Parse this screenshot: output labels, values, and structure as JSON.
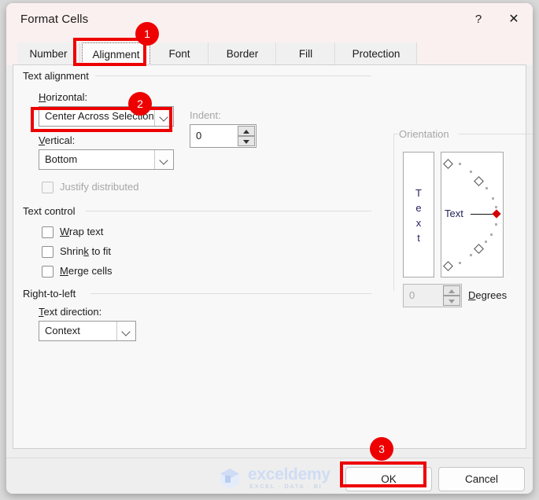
{
  "window": {
    "title": "Format Cells",
    "help_icon": "?",
    "close_icon": "✕"
  },
  "tabs": [
    {
      "label": "Number",
      "active": false
    },
    {
      "label": "Alignment",
      "active": true
    },
    {
      "label": "Font",
      "active": false
    },
    {
      "label": "Border",
      "active": false
    },
    {
      "label": "Fill",
      "active": false
    },
    {
      "label": "Protection",
      "active": false
    }
  ],
  "text_alignment": {
    "group_label": "Text alignment",
    "horizontal_label": "Horizontal:",
    "horizontal_value": "Center Across Selection",
    "vertical_label": "Vertical:",
    "vertical_value": "Bottom",
    "indent_label": "Indent:",
    "indent_value": "0",
    "justify_distributed_label": "Justify distributed",
    "justify_distributed_checked": false,
    "justify_distributed_enabled": false
  },
  "text_control": {
    "group_label": "Text control",
    "items": [
      {
        "label": "Wrap text",
        "checked": false
      },
      {
        "label": "Shrink to fit",
        "checked": false
      },
      {
        "label": "Merge cells",
        "checked": false
      }
    ]
  },
  "right_to_left": {
    "group_label": "Right-to-left",
    "text_direction_label": "Text direction:",
    "text_direction_value": "Context"
  },
  "orientation": {
    "group_label": "Orientation",
    "vertical_text_letters": [
      "T",
      "e",
      "x",
      "t"
    ],
    "dial_text": "Text",
    "degrees_value": "0",
    "degrees_label": "Degrees",
    "enabled": false
  },
  "footer": {
    "ok_label": "OK",
    "cancel_label": "Cancel"
  },
  "watermark": {
    "name": "exceldemy",
    "subtitle": "EXCEL · DATA · BI"
  },
  "annotations": [
    {
      "badge": "1",
      "target": "alignment-tab"
    },
    {
      "badge": "2",
      "target": "horizontal-combo"
    },
    {
      "badge": "3",
      "target": "ok-button"
    }
  ],
  "colors": {
    "annotation_red": "#ee0000",
    "titlebar_bg": "#faf0ef",
    "panel_bg": "#f8f8f8",
    "footer_bg": "#eeeeee",
    "dial_hub_red": "#d20000"
  }
}
